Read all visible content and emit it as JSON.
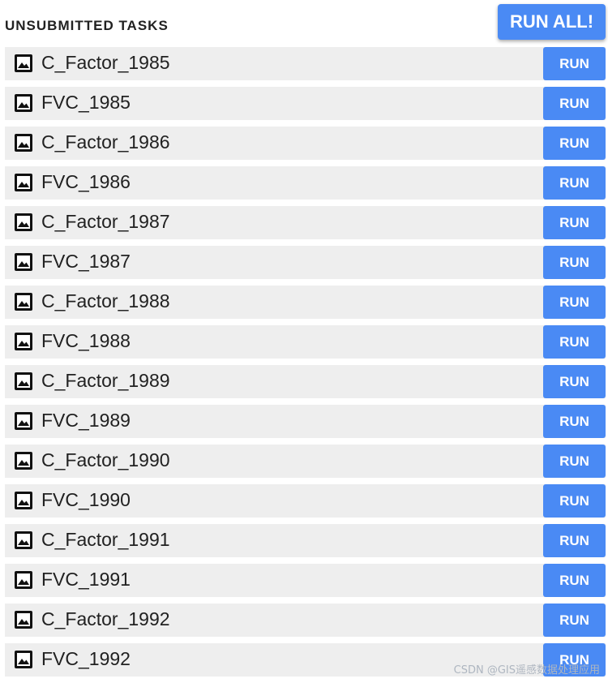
{
  "header": {
    "title": "UNSUBMITTED TASKS",
    "run_all_label": "RUN ALL!"
  },
  "tasks": [
    {
      "name": "C_Factor_1985",
      "icon": "image-icon",
      "button_label": "RUN"
    },
    {
      "name": "FVC_1985",
      "icon": "image-icon",
      "button_label": "RUN"
    },
    {
      "name": "C_Factor_1986",
      "icon": "image-icon",
      "button_label": "RUN"
    },
    {
      "name": "FVC_1986",
      "icon": "image-icon",
      "button_label": "RUN"
    },
    {
      "name": "C_Factor_1987",
      "icon": "image-icon",
      "button_label": "RUN"
    },
    {
      "name": "FVC_1987",
      "icon": "image-icon",
      "button_label": "RUN"
    },
    {
      "name": "C_Factor_1988",
      "icon": "image-icon",
      "button_label": "RUN"
    },
    {
      "name": "FVC_1988",
      "icon": "image-icon",
      "button_label": "RUN"
    },
    {
      "name": "C_Factor_1989",
      "icon": "image-icon",
      "button_label": "RUN"
    },
    {
      "name": "FVC_1989",
      "icon": "image-icon",
      "button_label": "RUN"
    },
    {
      "name": "C_Factor_1990",
      "icon": "image-icon",
      "button_label": "RUN"
    },
    {
      "name": "FVC_1990",
      "icon": "image-icon",
      "button_label": "RUN"
    },
    {
      "name": "C_Factor_1991",
      "icon": "image-icon",
      "button_label": "RUN"
    },
    {
      "name": "FVC_1991",
      "icon": "image-icon",
      "button_label": "RUN"
    },
    {
      "name": "C_Factor_1992",
      "icon": "image-icon",
      "button_label": "RUN"
    },
    {
      "name": "FVC_1992",
      "icon": "image-icon",
      "button_label": "RUN"
    }
  ],
  "watermark": "CSDN @GIS遥感数据处理应用",
  "colors": {
    "accent": "#4a8af4",
    "row_background": "#eeeeee",
    "text": "#212121"
  }
}
